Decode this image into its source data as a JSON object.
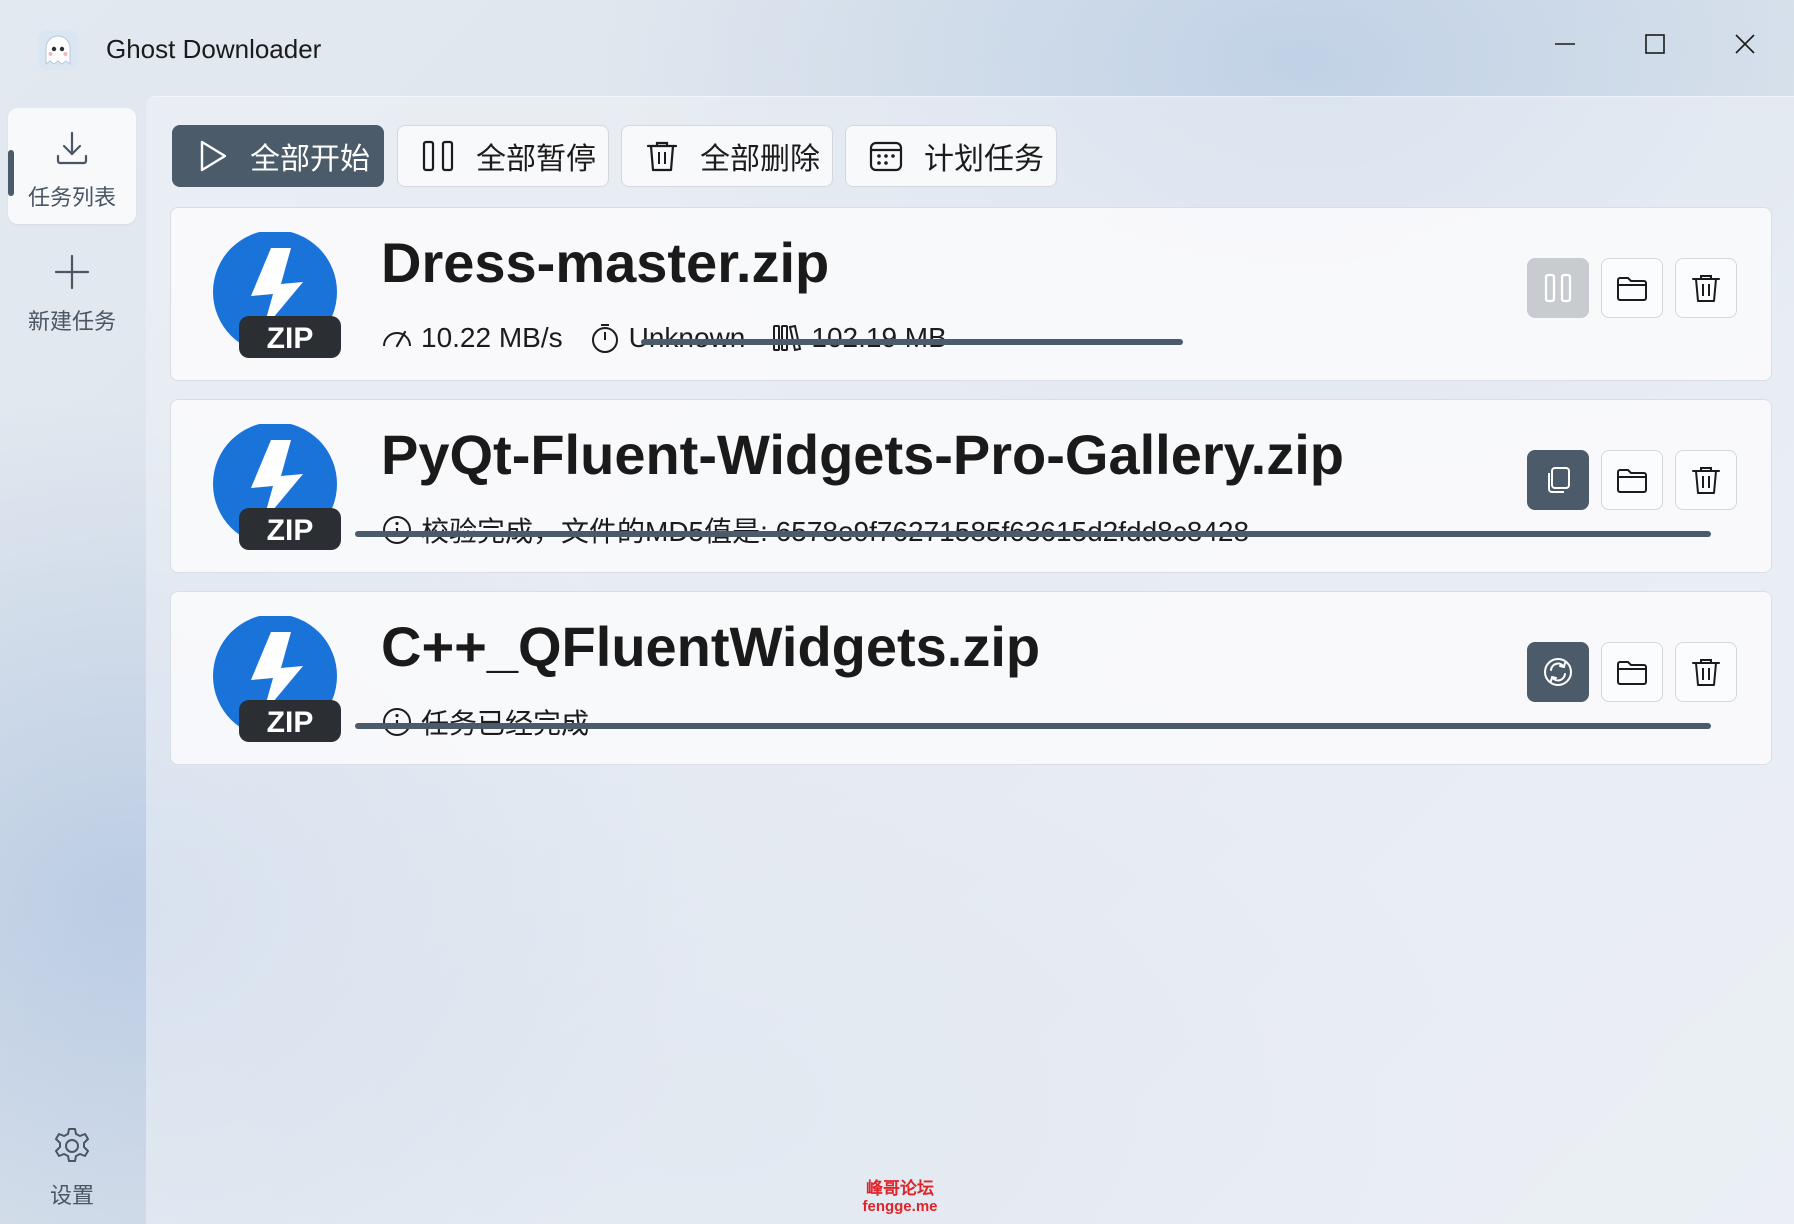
{
  "app": {
    "title": "Ghost Downloader"
  },
  "window_controls": {
    "minimize": "minimize-icon",
    "maximize": "maximize-icon",
    "close": "close-icon"
  },
  "sidebar": {
    "items": [
      {
        "label": "任务列表",
        "icon": "download-icon",
        "active": true
      },
      {
        "label": "新建任务",
        "icon": "plus-icon",
        "active": false
      },
      {
        "label": "设置",
        "icon": "gear-icon",
        "active": false
      }
    ]
  },
  "toolbar": {
    "start_all": "全部开始",
    "pause_all": "全部暂停",
    "delete_all": "全部删除",
    "plan_task": "计划任务"
  },
  "tasks": [
    {
      "filename": "Dress-master.zip",
      "speed": "10.22 MB/s",
      "eta": "Unknown",
      "size": "102.19 MB",
      "progress": 0.4,
      "primary_action": "pause-icon",
      "primary_enabled": false
    },
    {
      "filename": "PyQt-Fluent-Widgets-Pro-Gallery.zip",
      "status": "校验完成，文件的MD5值是: 6578e9f76271585f63615d2fdd8c8428",
      "progress": 1.0,
      "primary_action": "copy-icon"
    },
    {
      "filename": "C++_QFluentWidgets.zip",
      "status": "任务已经完成",
      "progress": 1.0,
      "primary_action": "refresh-icon"
    }
  ],
  "file_badge": "ZIP",
  "watermark": {
    "line1": "峰哥论坛",
    "line2": "fengge.me"
  },
  "colors": {
    "accent": "#4b5b69",
    "zip_blue": "#1a73d9",
    "badge_dark": "#2b2f33",
    "watermark_red": "#e0242a"
  }
}
